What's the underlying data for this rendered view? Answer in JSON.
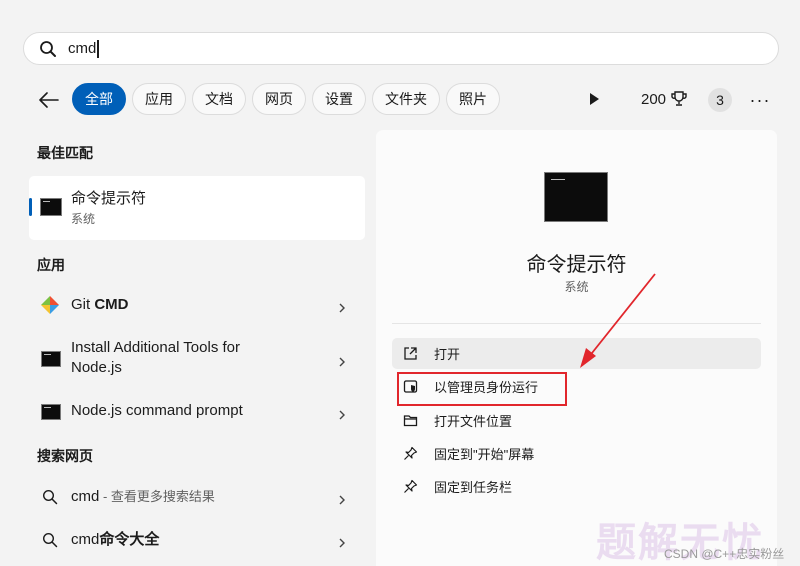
{
  "search": {
    "query": "cmd"
  },
  "filters": {
    "chips": [
      "全部",
      "应用",
      "文档",
      "网页",
      "设置",
      "文件夹",
      "照片"
    ],
    "active_index": 0
  },
  "toolbar": {
    "points": "200",
    "badge_count": "3",
    "more": "···"
  },
  "best_match": {
    "title": "最佳匹配",
    "item": {
      "name": "命令提示符",
      "type": "系统"
    }
  },
  "apps": {
    "title": "应用",
    "items": [
      {
        "name_plain": "Git ",
        "name_bold": "CMD"
      },
      {
        "line1": "Install Additional Tools for",
        "line2": "Node.js"
      },
      {
        "name": "Node.js command prompt"
      }
    ]
  },
  "web": {
    "title": "搜索网页",
    "items": [
      {
        "term": "cmd",
        "suffix": " - 查看更多搜索结果"
      },
      {
        "term": "cmd",
        "suffix_bold": "命令大全"
      }
    ]
  },
  "detail": {
    "name": "命令提示符",
    "type": "系统",
    "actions": [
      {
        "label": "打开",
        "icon": "open-external-icon"
      },
      {
        "label": "以管理员身份运行",
        "icon": "shield-admin-icon"
      },
      {
        "label": "打开文件位置",
        "icon": "folder-icon"
      },
      {
        "label": "固定到\"开始\"屏幕",
        "icon": "pin-icon"
      },
      {
        "label": "固定到任务栏",
        "icon": "pin-icon"
      }
    ]
  },
  "colors": {
    "accent": "#005fb8",
    "annotation": "#e1262c"
  },
  "watermark": "题解无忧",
  "credit": "CSDN @C++忠实粉丝"
}
